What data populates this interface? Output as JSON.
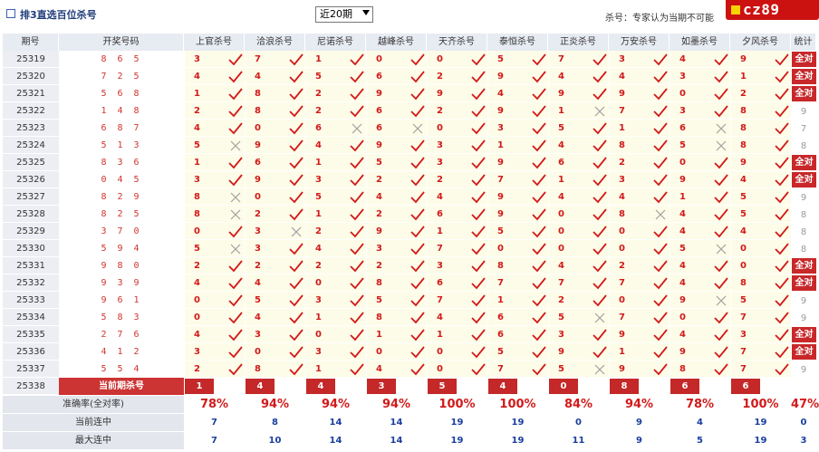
{
  "header": {
    "title": "排3直选百位杀号",
    "select_value": "近20期",
    "note": "杀号：专家认为当期不可能",
    "logo_text": "cz89.com",
    "logo_visible_text": "cz89"
  },
  "columns": {
    "period": "期号",
    "numbers": "开奖号码",
    "experts": [
      "上官杀号",
      "洽浪杀号",
      "尼诺杀号",
      "越峰杀号",
      "天齐杀号",
      "泰恒杀号",
      "正炎杀号",
      "万安杀号",
      "如墨杀号",
      "夕风杀号"
    ],
    "count": "统计"
  },
  "rows": [
    {
      "period": "25319",
      "numbers": "8 6 5",
      "kills": [
        3,
        7,
        1,
        0,
        0,
        5,
        7,
        3,
        4,
        9
      ],
      "marks": [
        1,
        1,
        1,
        1,
        1,
        1,
        1,
        1,
        1,
        1
      ],
      "count": "全对"
    },
    {
      "period": "25320",
      "numbers": "7 2 5",
      "kills": [
        4,
        4,
        5,
        6,
        2,
        9,
        4,
        4,
        3,
        1
      ],
      "marks": [
        1,
        1,
        1,
        1,
        1,
        1,
        1,
        1,
        1,
        1
      ],
      "count": "全对"
    },
    {
      "period": "25321",
      "numbers": "5 6 8",
      "kills": [
        1,
        8,
        2,
        9,
        9,
        4,
        9,
        9,
        0,
        2
      ],
      "marks": [
        1,
        1,
        1,
        1,
        1,
        1,
        1,
        1,
        1,
        1
      ],
      "count": "全对"
    },
    {
      "period": "25322",
      "numbers": "1 4 8",
      "kills": [
        2,
        8,
        2,
        6,
        2,
        9,
        1,
        7,
        3,
        8
      ],
      "marks": [
        1,
        1,
        1,
        1,
        1,
        1,
        0,
        1,
        1,
        1
      ],
      "count": "9"
    },
    {
      "period": "25323",
      "numbers": "6 8 7",
      "kills": [
        4,
        0,
        6,
        6,
        0,
        3,
        5,
        1,
        6,
        8
      ],
      "marks": [
        1,
        1,
        0,
        0,
        1,
        1,
        1,
        1,
        0,
        1
      ],
      "count": "7"
    },
    {
      "period": "25324",
      "numbers": "5 1 3",
      "kills": [
        5,
        9,
        4,
        9,
        3,
        1,
        4,
        8,
        5,
        8
      ],
      "marks": [
        0,
        1,
        1,
        1,
        1,
        1,
        1,
        1,
        0,
        1
      ],
      "count": "8"
    },
    {
      "period": "25325",
      "numbers": "8 3 6",
      "kills": [
        1,
        6,
        1,
        5,
        3,
        9,
        6,
        2,
        0,
        9
      ],
      "marks": [
        1,
        1,
        1,
        1,
        1,
        1,
        1,
        1,
        1,
        1
      ],
      "count": "全对"
    },
    {
      "period": "25326",
      "numbers": "0 4 5",
      "kills": [
        3,
        9,
        3,
        2,
        2,
        7,
        1,
        3,
        9,
        4
      ],
      "marks": [
        1,
        1,
        1,
        1,
        1,
        1,
        1,
        1,
        1,
        1
      ],
      "count": "全对"
    },
    {
      "period": "25327",
      "numbers": "8 2 9",
      "kills": [
        8,
        0,
        5,
        4,
        4,
        9,
        4,
        4,
        1,
        5
      ],
      "marks": [
        0,
        1,
        1,
        1,
        1,
        1,
        1,
        1,
        1,
        1
      ],
      "count": "9"
    },
    {
      "period": "25328",
      "numbers": "8 2 5",
      "kills": [
        8,
        2,
        1,
        2,
        6,
        9,
        0,
        8,
        4,
        5
      ],
      "marks": [
        0,
        1,
        1,
        1,
        1,
        1,
        1,
        0,
        1,
        1
      ],
      "count": "8"
    },
    {
      "period": "25329",
      "numbers": "3 7 0",
      "kills": [
        0,
        3,
        2,
        9,
        1,
        5,
        0,
        0,
        4,
        4
      ],
      "marks": [
        1,
        0,
        1,
        1,
        1,
        1,
        1,
        1,
        1,
        1
      ],
      "count": "8"
    },
    {
      "period": "25330",
      "numbers": "5 9 4",
      "kills": [
        5,
        3,
        4,
        3,
        7,
        0,
        0,
        0,
        5,
        0
      ],
      "marks": [
        0,
        1,
        1,
        1,
        1,
        1,
        1,
        1,
        0,
        1
      ],
      "count": "8"
    },
    {
      "period": "25331",
      "numbers": "9 8 0",
      "kills": [
        2,
        2,
        2,
        2,
        3,
        8,
        4,
        2,
        4,
        0
      ],
      "marks": [
        1,
        1,
        1,
        1,
        1,
        1,
        1,
        1,
        1,
        1
      ],
      "count": "全对"
    },
    {
      "period": "25332",
      "numbers": "9 3 9",
      "kills": [
        4,
        4,
        0,
        8,
        6,
        7,
        7,
        7,
        4,
        8
      ],
      "marks": [
        1,
        1,
        1,
        1,
        1,
        1,
        1,
        1,
        1,
        1
      ],
      "count": "全对"
    },
    {
      "period": "25333",
      "numbers": "9 6 1",
      "kills": [
        0,
        5,
        3,
        5,
        7,
        1,
        2,
        0,
        9,
        5
      ],
      "marks": [
        1,
        1,
        1,
        1,
        1,
        1,
        1,
        1,
        0,
        1
      ],
      "count": "9"
    },
    {
      "period": "25334",
      "numbers": "5 8 3",
      "kills": [
        0,
        4,
        1,
        8,
        4,
        6,
        5,
        7,
        0,
        7
      ],
      "marks": [
        1,
        1,
        1,
        1,
        1,
        1,
        0,
        1,
        1,
        1
      ],
      "count": "9"
    },
    {
      "period": "25335",
      "numbers": "2 7 6",
      "kills": [
        4,
        3,
        0,
        1,
        1,
        6,
        3,
        9,
        4,
        3
      ],
      "marks": [
        1,
        1,
        1,
        1,
        1,
        1,
        1,
        1,
        1,
        1
      ],
      "count": "全对"
    },
    {
      "period": "25336",
      "numbers": "4 1 2",
      "kills": [
        3,
        0,
        3,
        0,
        0,
        5,
        9,
        1,
        9,
        7
      ],
      "marks": [
        1,
        1,
        1,
        1,
        1,
        1,
        1,
        1,
        1,
        1
      ],
      "count": "全对"
    },
    {
      "period": "25337",
      "numbers": "5 5 4",
      "kills": [
        2,
        8,
        1,
        4,
        0,
        7,
        5,
        9,
        8,
        7
      ],
      "marks": [
        1,
        1,
        1,
        1,
        1,
        1,
        0,
        1,
        1,
        1
      ],
      "count": "9"
    }
  ],
  "current": {
    "period": "25338",
    "label": "当前期杀号",
    "kills": [
      "1",
      "4",
      "4",
      "3",
      "5",
      "4",
      "0",
      "8",
      "6",
      "6"
    ]
  },
  "summary": [
    {
      "label": "准确率(全对率)",
      "values": [
        "78%",
        "94%",
        "94%",
        "94%",
        "100%",
        "100%",
        "84%",
        "94%",
        "78%",
        "100%"
      ],
      "total": "47%"
    },
    {
      "label": "当前连中",
      "values": [
        "7",
        "8",
        "14",
        "14",
        "19",
        "19",
        "0",
        "9",
        "4",
        "19"
      ],
      "total": "0"
    },
    {
      "label": "最大连中",
      "values": [
        "7",
        "10",
        "14",
        "14",
        "19",
        "19",
        "11",
        "9",
        "5",
        "19"
      ],
      "total": "3"
    }
  ],
  "colors": {
    "accent_red": "#c8282a",
    "header_bg": "#e7ebf2",
    "cell_bg": "#fdfce8",
    "blue": "#1a3fa0"
  }
}
